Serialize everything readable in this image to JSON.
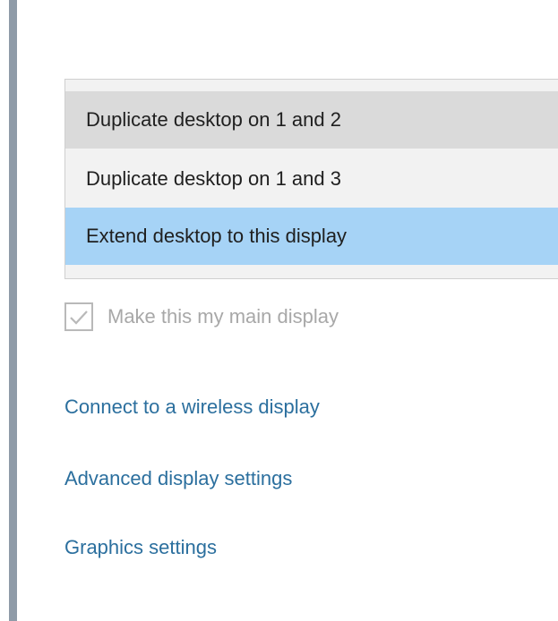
{
  "projection_options": [
    {
      "label": "Duplicate desktop on 1 and 2",
      "state": "hover"
    },
    {
      "label": "Duplicate desktop on 1 and 3",
      "state": "normal"
    },
    {
      "label": "Extend desktop to this display",
      "state": "selected"
    }
  ],
  "main_display_checkbox": {
    "label": "Make this my main display",
    "checked": true,
    "disabled": true
  },
  "links": {
    "wireless": "Connect to a wireless display",
    "advanced": "Advanced display settings",
    "graphics": "Graphics settings"
  },
  "colors": {
    "accent_link": "#2b6f9e",
    "selected_option": "#a6d3f6",
    "hover_option": "#dadada",
    "rail": "#8f9ba8"
  },
  "icons": {
    "checkbox": "checkmark-icon"
  }
}
